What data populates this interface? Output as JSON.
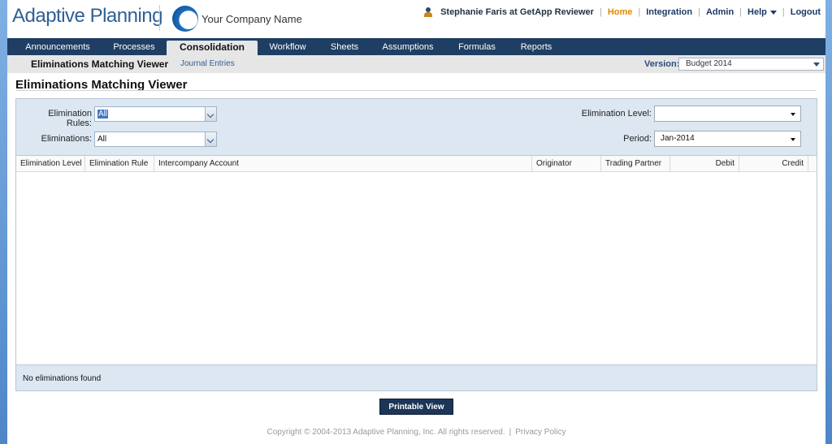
{
  "header": {
    "logo_text": "Adaptive Planning",
    "company_name": "Your Company Name",
    "user": "Stephanie Faris at GetApp Reviewer",
    "nav": [
      "Home",
      "Integration",
      "Admin",
      "Help",
      "Logout"
    ]
  },
  "tabs": [
    "Announcements",
    "Processes",
    "Consolidation",
    "Workflow",
    "Sheets",
    "Assumptions",
    "Formulas",
    "Reports"
  ],
  "active_tab": "Consolidation",
  "subnav": {
    "title": "Eliminations Matching Viewer",
    "link": "Journal Entries",
    "version_label": "Version:",
    "version_value": "Budget 2014"
  },
  "page_title": "Eliminations Matching Viewer",
  "filters": {
    "elimination_rules_label": "Elimination Rules:",
    "elimination_rules_value": "All",
    "eliminations_label": "Eliminations:",
    "eliminations_value": "All",
    "elimination_level_label": "Elimination Level:",
    "elimination_level_value": "",
    "period_label": "Period:",
    "period_value": "Jan-2014"
  },
  "grid": {
    "columns": [
      "Elimination Level",
      "Elimination Rule",
      "Intercompany Account",
      "Originator",
      "Trading Partner",
      "Debit",
      "Credit"
    ],
    "empty_message": "No eliminations found"
  },
  "print_button": "Printable View",
  "footer": {
    "copyright": "Copyright © 2004-2013 Adaptive Planning, Inc. All rights reserved.",
    "privacy": "Privacy Policy"
  },
  "colors": {
    "brand_navy": "#1f3e63",
    "accent_orange": "#e08a00",
    "panel_blue": "#dce7f2"
  }
}
